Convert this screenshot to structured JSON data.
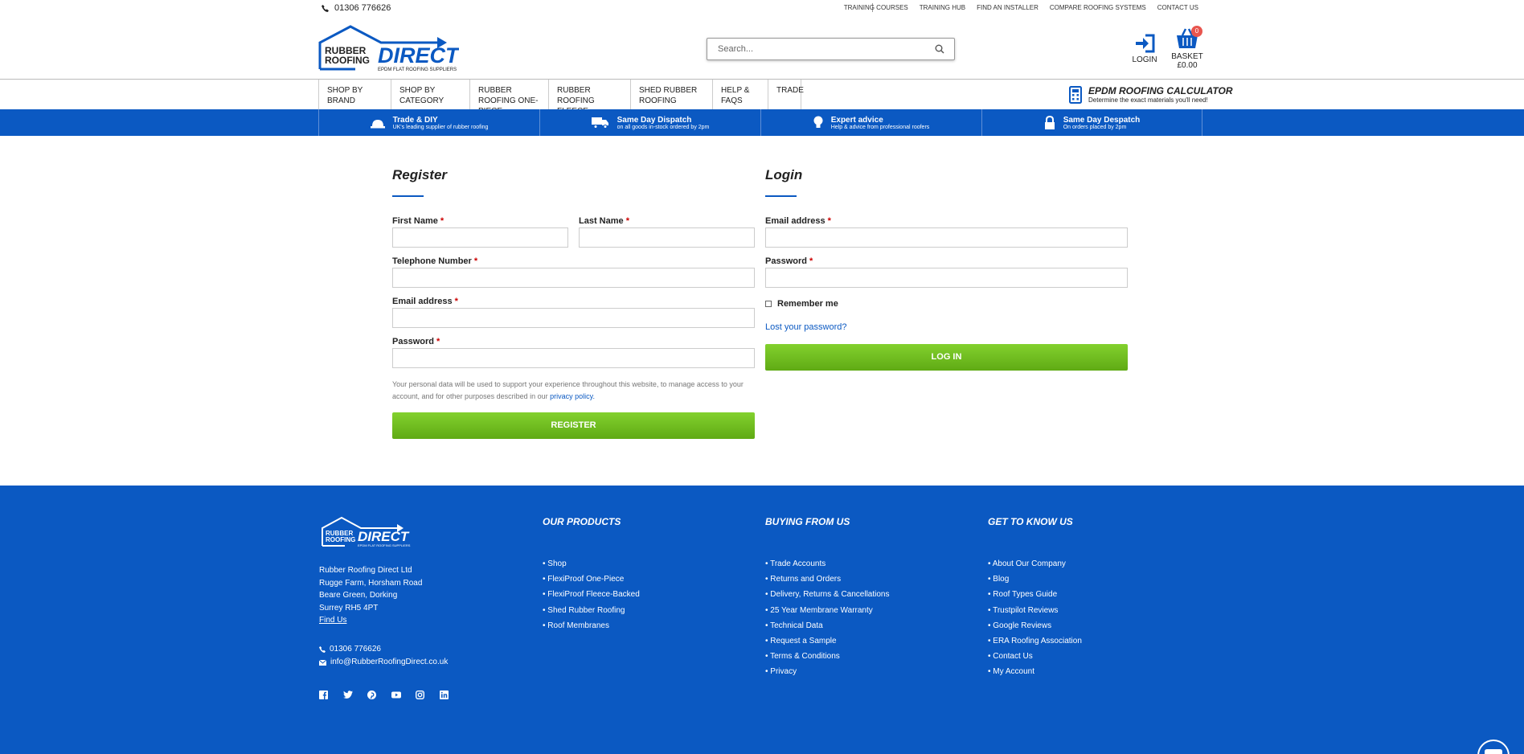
{
  "topbar": {
    "phone": "01306 776626",
    "links": [
      "TRAINING COURSES",
      "TRAINING HUB",
      "FIND AN INSTALLER",
      "COMPARE ROOFING SYSTEMS",
      "CONTACT US"
    ]
  },
  "header": {
    "logo": {
      "line1": "RUBBER",
      "line2": "ROOFING",
      "brand": "DIRECT",
      "tagline": "EPDM FLAT ROOFING SUPPLIERS"
    },
    "search_placeholder": "Search...",
    "login_label": "LOGIN",
    "basket_label": "BASKET",
    "basket_total": "£0.00",
    "basket_count": "0"
  },
  "nav": {
    "items": [
      "SHOP BY BRAND",
      "SHOP BY CATEGORY",
      "RUBBER ROOFING ONE-PIECE",
      "RUBBER ROOFING FLEECE-BACKED",
      "SHED RUBBER ROOFING",
      "HELP & FAQS",
      "TRADE"
    ],
    "calculator_title": "EPDM ROOFING CALCULATOR",
    "calculator_sub": "Determine the exact materials you'll need!"
  },
  "usps": [
    {
      "title": "Trade & DIY",
      "sub": "UK's leading supplier of rubber roofing",
      "icon": "hard-hat-icon"
    },
    {
      "title": "Same Day Dispatch",
      "sub": "on all goods in-stock ordered by 2pm",
      "icon": "truck-icon"
    },
    {
      "title": "Expert advice",
      "sub": "Help & advice from professional roofers",
      "icon": "lightbulb-icon"
    },
    {
      "title": "Same Day Despatch",
      "sub": "On orders placed by 2pm",
      "icon": "lock-icon"
    }
  ],
  "register": {
    "heading": "Register",
    "first_name": "First Name",
    "last_name": "Last Name",
    "telephone": "Telephone Number",
    "email": "Email address",
    "password": "Password",
    "privacy_text": "Your personal data will be used to support your experience throughout this website, to manage access to your account, and for other purposes described in our",
    "privacy_link": "privacy policy.",
    "button": "REGISTER"
  },
  "login": {
    "heading": "Login",
    "email": "Email address",
    "password": "Password",
    "remember": "Remember me",
    "lost": "Lost your password?",
    "button": "LOG IN"
  },
  "required_mark": "*",
  "footer": {
    "address": [
      "Rubber Roofing Direct Ltd",
      "Rugge Farm, Horsham Road",
      "Beare Green, Dorking",
      "Surrey RH5 4PT"
    ],
    "find_us": "Find Us",
    "phone": "01306 776626",
    "email": "info@RubberRoofingDirect.co.uk",
    "columns": [
      {
        "title": "OUR PRODUCTS",
        "items": [
          "Shop",
          "FlexiProof One-Piece",
          "FlexiProof Fleece-Backed",
          "Shed Rubber Roofing",
          "Roof Membranes"
        ]
      },
      {
        "title": "BUYING FROM US",
        "items": [
          "Trade Accounts",
          "Returns and Orders",
          "Delivery, Returns & Cancellations",
          "25 Year Membrane Warranty",
          "Technical Data",
          "Request a Sample",
          "Terms & Conditions",
          "Privacy"
        ]
      },
      {
        "title": "GET TO KNOW US",
        "items": [
          "About Our Company",
          "Blog",
          "Roof Types Guide",
          "Trustpilot Reviews",
          "Google Reviews",
          "ERA Roofing Association",
          "Contact Us",
          "My Account"
        ]
      }
    ],
    "social": [
      "facebook-icon",
      "twitter-icon",
      "pinterest-icon",
      "youtube-icon",
      "instagram-icon",
      "linkedin-icon"
    ]
  },
  "colors": {
    "brand_blue": "#0b59c2",
    "button_green": "#6cbb1f",
    "required_red": "#cc0000",
    "badge_red": "#e8554e"
  }
}
